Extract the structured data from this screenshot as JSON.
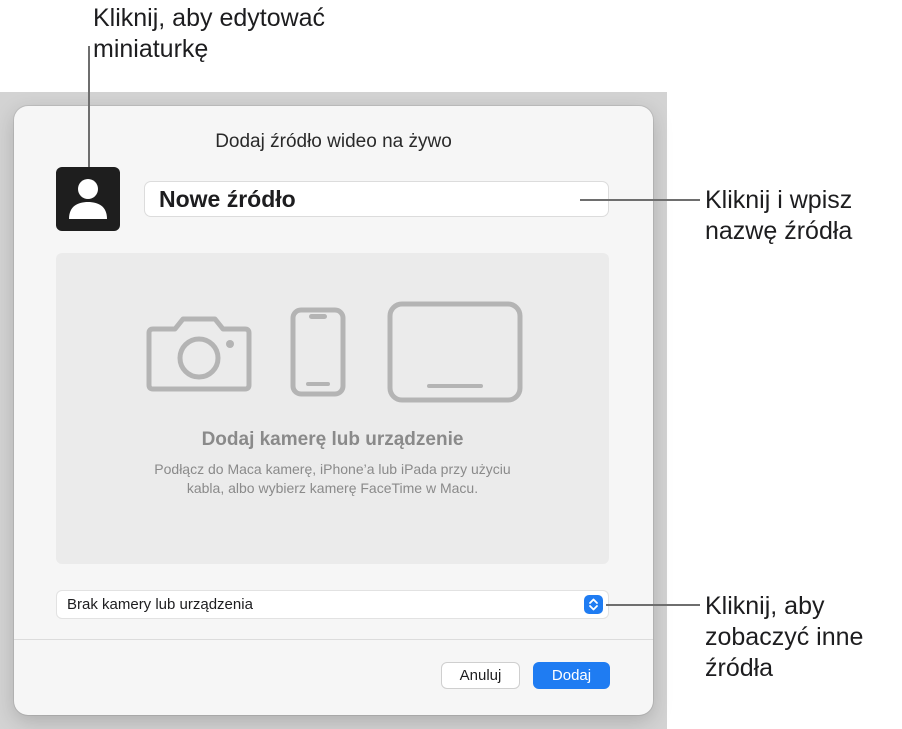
{
  "dialog": {
    "title": "Dodaj źródło wideo na żywo",
    "thumbnail_icon": "person-silhouette-icon",
    "name_field_value": "Nowe źródło",
    "dropzone": {
      "icons": [
        "camera-icon",
        "iphone-icon",
        "ipad-icon"
      ],
      "heading": "Dodaj kamerę lub urządzenie",
      "description_line1": "Podłącz do Maca kamerę, iPhone’a lub iPada przy użyciu",
      "description_line2": "kabla, albo wybierz kamerę FaceTime w Macu."
    },
    "source_select": {
      "value": "Brak kamery lub urządzenia",
      "stepper_icon": "up-down-chevron-icon"
    },
    "buttons": {
      "cancel": "Anuluj",
      "add": "Dodaj"
    }
  },
  "callouts": {
    "thumbnail_line1": "Kliknij, aby edytować",
    "thumbnail_line2": "miniaturkę",
    "name_line1": "Kliknij i wpisz",
    "name_line2": "nazwę źródła",
    "sources_line1": "Kliknij, aby",
    "sources_line2": "zobaczyć inne",
    "sources_line3": "źródła"
  },
  "colors": {
    "accent": "#1f7cf2",
    "backdrop": "#d3d3d3",
    "dialog_bg": "#f6f6f6",
    "dropzone_bg": "#ebebeb",
    "placeholder_icon": "#b4b4b4"
  }
}
